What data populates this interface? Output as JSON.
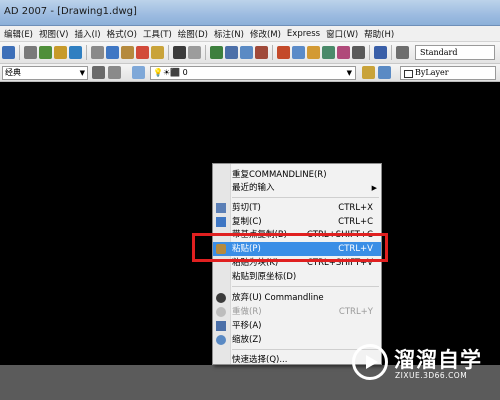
{
  "window": {
    "title": "AD 2007 - [Drawing1.dwg]"
  },
  "menubar": {
    "items": [
      "编辑(E)",
      "视图(V)",
      "插入(I)",
      "格式(O)",
      "工具(T)",
      "绘图(D)",
      "标注(N)",
      "修改(M)",
      "Express",
      "窗口(W)",
      "帮助(H)"
    ]
  },
  "toolbar": {
    "text_style": "Standard"
  },
  "workspace": {
    "value": "经典"
  },
  "layer": {
    "value": "0"
  },
  "color": {
    "value": "ByLayer"
  },
  "context_menu": {
    "repeat": "重复COMMANDLINE(R)",
    "recent": "最近的输入",
    "cut": "剪切(T)",
    "cut_sc": "CTRL+X",
    "copy": "复制(C)",
    "copy_sc": "CTRL+C",
    "copy_base": "带基点复制(B)",
    "copy_base_sc": "CTRL+SHIFT+C",
    "paste": "粘贴(P)",
    "paste_sc": "CTRL+V",
    "paste_block": "粘贴为块(K)",
    "paste_block_sc": "CTRL+SHIFT+V",
    "paste_orig": "粘贴到原坐标(D)",
    "undo": "放弃(U) Commandline",
    "redo": "重做(R)",
    "redo_sc": "CTRL+Y",
    "pan": "平移(A)",
    "zoom": "缩放(Z)",
    "quick_select": "快速选择(Q)..."
  },
  "watermark": {
    "brand": "溜溜自学",
    "url": "ZIXUE.3D66.COM"
  },
  "colors": {
    "highlight": "#3a8ee6",
    "callout": "#e02020",
    "canvas": "#000000"
  }
}
